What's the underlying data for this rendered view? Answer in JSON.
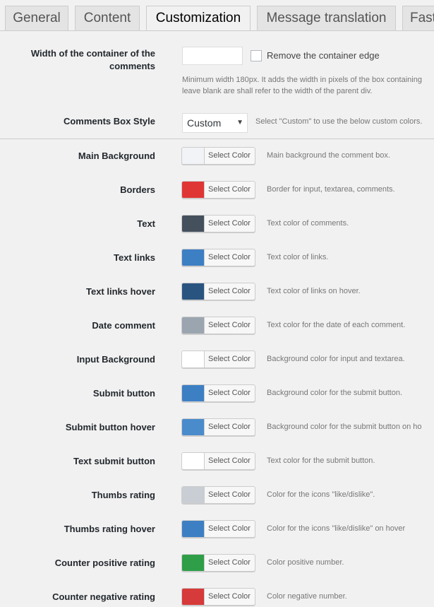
{
  "tabs": [
    {
      "label": "General"
    },
    {
      "label": "Content"
    },
    {
      "label": "Customization"
    },
    {
      "label": "Message translation"
    },
    {
      "label": "Fast"
    }
  ],
  "container": {
    "label_line1": "Width of the container of the",
    "label_line2": "comments",
    "input_value": "",
    "checkbox_label": "Remove the container edge",
    "checkbox_checked": false,
    "help_line1": "Minimum width 180px. It adds the width in pixels of the box containing",
    "help_line2": "leave blank are shall refer to the width of the parent div."
  },
  "box_style": {
    "label": "Comments Box Style",
    "selected": "Custom",
    "help": "Select \"Custom\" to use the below custom colors."
  },
  "color_rows": [
    {
      "label": "Main Background",
      "button": "Select Color",
      "color": "#f1f3f6",
      "desc": "Main background the comment box."
    },
    {
      "label": "Borders",
      "button": "Select Color",
      "color": "#e03535",
      "desc": "Border for input, textarea, comments."
    },
    {
      "label": "Text",
      "button": "Select Color",
      "color": "#44505c",
      "desc": "Text color of comments."
    },
    {
      "label": "Text links",
      "button": "Select Color",
      "color": "#3d7fc3",
      "desc": "Text color of links."
    },
    {
      "label": "Text links hover",
      "button": "Select Color",
      "color": "#2a5480",
      "desc": "Text color of links on hover."
    },
    {
      "label": "Date comment",
      "button": "Select Color",
      "color": "#9ba5b0",
      "desc": "Text color for the date of each comment."
    },
    {
      "label": "Input Background",
      "button": "Select Color",
      "color": "#ffffff",
      "desc": "Background color for input and textarea."
    },
    {
      "label": "Submit button",
      "button": "Select Color",
      "color": "#3d7fc3",
      "desc": "Background color for the submit button."
    },
    {
      "label": "Submit button hover",
      "button": "Select Color",
      "color": "#4a8bcc",
      "desc": "Background color for the submit button on ho"
    },
    {
      "label": "Text submit button",
      "button": "Select Color",
      "color": "#ffffff",
      "desc": "Text color for the submit button."
    },
    {
      "label": "Thumbs rating",
      "button": "Select Color",
      "color": "#c9ced5",
      "desc": "Color for the icons \"like/dislike\"."
    },
    {
      "label": "Thumbs rating hover",
      "button": "Select Color",
      "color": "#3d7fc3",
      "desc": "Color for the icons \"like/dislike\" on hover"
    },
    {
      "label": "Counter positive rating",
      "button": "Select Color",
      "color": "#2e9e48",
      "desc": "Color positive number."
    },
    {
      "label": "Counter negative rating",
      "button": "Select Color",
      "color": "#d63a3a",
      "desc": "Color negative number."
    }
  ]
}
